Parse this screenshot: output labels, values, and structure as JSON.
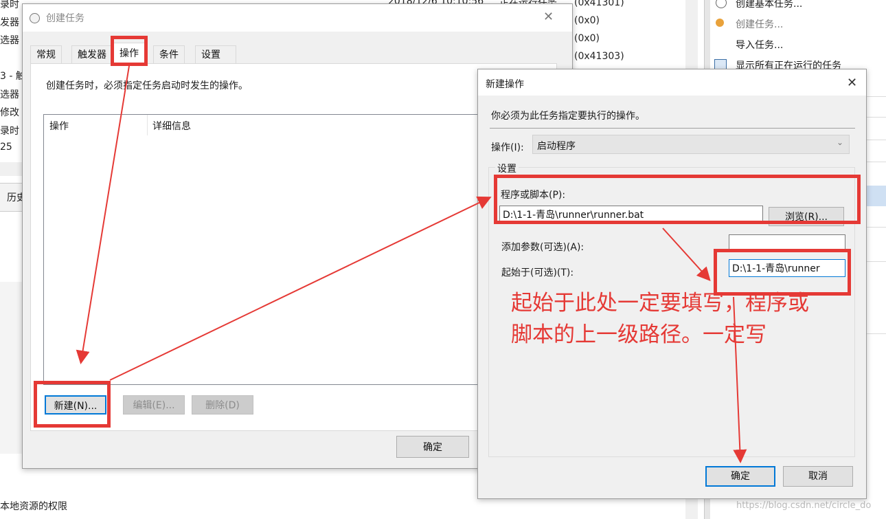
{
  "background": {
    "left_labels": [
      "录时",
      "发器",
      "选器",
      "3 - 触",
      "选器",
      "修改",
      "录时",
      "25"
    ],
    "history_tab": "历史",
    "bottom_left_text": "本地资源的权限",
    "top_timestamp": "2018/12/6 10:10:56",
    "top_status": "正在运行任务",
    "result_codes": [
      "(0x41301)",
      "(0x0)",
      "(0x0)",
      "(0x41303)"
    ],
    "actions_pane": [
      {
        "icon": "task-wizard-icon",
        "label": "创建基本任务..."
      },
      {
        "icon": "create-task-icon",
        "label": "创建任务..."
      },
      {
        "icon": "",
        "label": "导入任务..."
      },
      {
        "icon": "running-tasks-icon",
        "label": "显示所有正在运行的任务"
      }
    ],
    "watermark": "https://blog.csdn.net/circle_do"
  },
  "create_task_dialog": {
    "title": "创建任务",
    "tabs": [
      "常规",
      "触发器",
      "操作",
      "条件",
      "设置"
    ],
    "active_tab": "操作",
    "description": "创建任务时，必须指定任务启动时发生的操作。",
    "columns": [
      "操作",
      "详细信息"
    ],
    "buttons": {
      "new": "新建(N)...",
      "edit": "编辑(E)...",
      "delete": "删除(D)",
      "ok": "确定"
    }
  },
  "new_action_dialog": {
    "title": "新建操作",
    "instruction": "你必须为此任务指定要执行的操作。",
    "action_label": "操作(I):",
    "action_value": "启动程序",
    "settings_group": "设置",
    "program_label": "程序或脚本(P):",
    "program_value": "D:\\1-1-青岛\\runner\\runner.bat",
    "browse": "浏览(R)...",
    "args_label": "添加参数(可选)(A):",
    "args_value": "",
    "start_in_label": "起始于(可选)(T):",
    "start_in_value": "D:\\1-1-青岛\\runner",
    "ok": "确定",
    "cancel": "取消"
  },
  "annotation": {
    "line1": "起始于此处一定要填写，程序或",
    "line2": "脚本的上一级路径。一定写"
  }
}
